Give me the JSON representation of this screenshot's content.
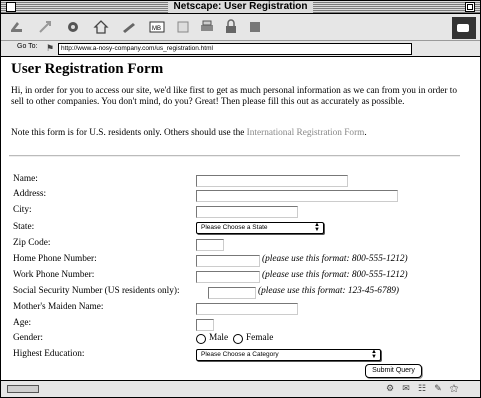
{
  "window": {
    "title": "Netscape: User Registration"
  },
  "toolbar": {
    "buttons": [
      {
        "name": "back-icon"
      },
      {
        "name": "forward-icon"
      },
      {
        "name": "reload-icon"
      },
      {
        "name": "home-icon"
      },
      {
        "name": "search-icon"
      },
      {
        "name": "mail-icon"
      },
      {
        "name": "images-icon"
      },
      {
        "name": "print-icon"
      },
      {
        "name": "security-icon"
      },
      {
        "name": "stop-icon"
      }
    ]
  },
  "location": {
    "label": "Go To:",
    "url": "http://www.a-nosy-company.com/us_registration.html"
  },
  "page": {
    "title": "User Registration Form",
    "intro": "Hi, in order for you to access our site, we'd like first to get as much personal information as we can from you in order to sell to other companies. You don't mind, do you? Great! Then please fill this out as accurately as possible.",
    "note_prefix": "Note this form is for U.S. residents only. Others should use the ",
    "note_link": "International Registration Form",
    "note_suffix": "."
  },
  "form": {
    "labels": {
      "name": "Name:",
      "address": "Address:",
      "city": "City:",
      "state": "State:",
      "zip": "Zip Code:",
      "home_phone": "Home Phone Number:",
      "work_phone": "Work Phone Number:",
      "ssn": "Social Security Number (US residents only):",
      "maiden_name": "Mother's Maiden Name:",
      "age": "Age:",
      "gender": "Gender:",
      "education": "Highest Education:"
    },
    "hints": {
      "home_phone": "(please use this format: 800-555-1212)",
      "work_phone": "(please use this format: 800-555-1212)",
      "ssn": "(please use this format: 123-45-6789)"
    },
    "state_select": "Please Choose a State",
    "education_select": "Please Choose a Category",
    "gender_options": {
      "male": "Male",
      "female": "Female"
    },
    "submit_label": "Submit Query"
  }
}
